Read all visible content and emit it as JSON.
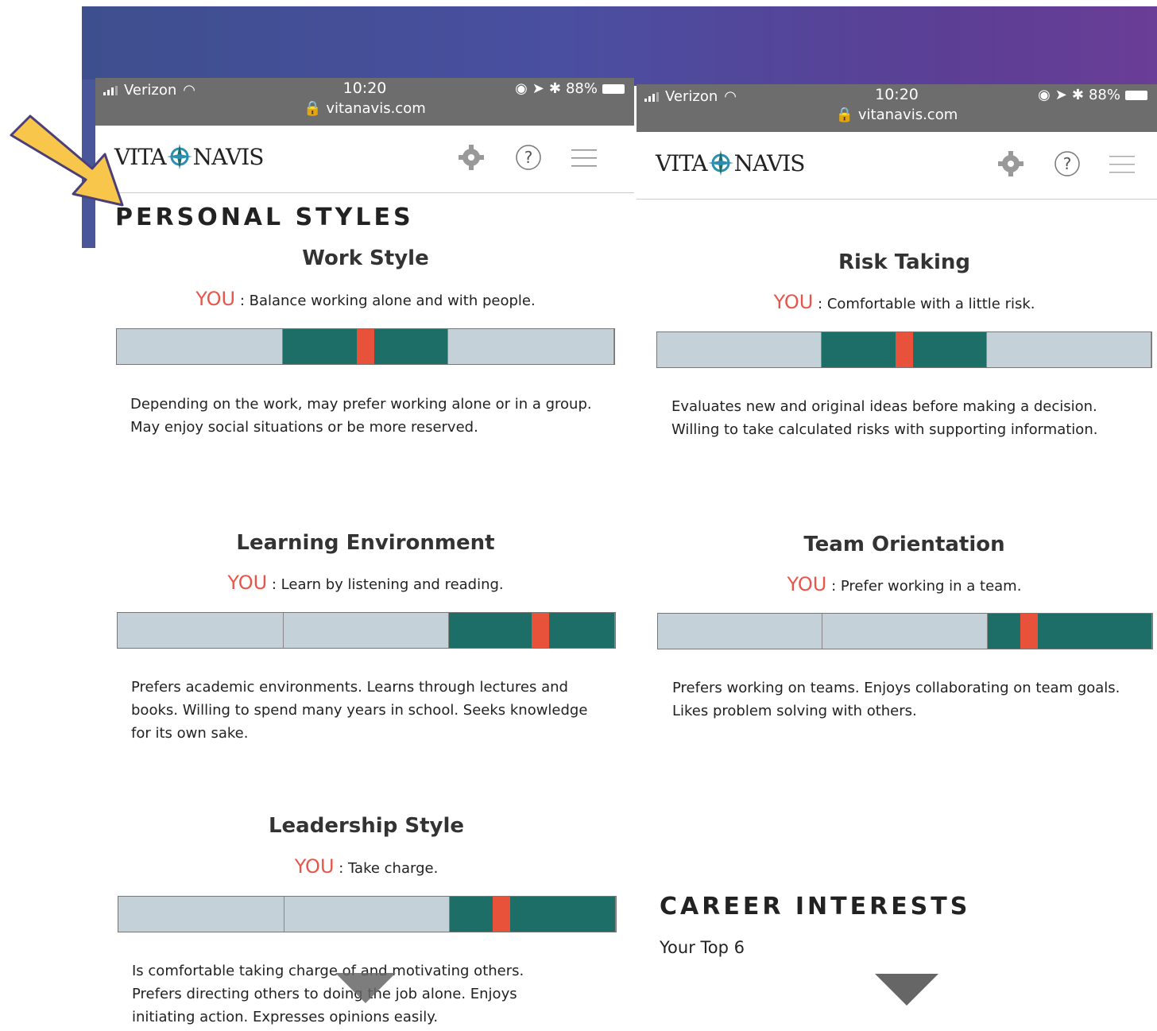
{
  "status_left": {
    "carrier": "Verizon",
    "time": "10:20",
    "url": "vitanavis.com",
    "battery": "88%"
  },
  "status_right": {
    "carrier": "Verizon",
    "time": "10:20",
    "url": "vitanavis.com",
    "battery": "88%"
  },
  "logo": {
    "left_text": "VITA",
    "right_text": "NAVIS"
  },
  "sections": {
    "personal_styles": "PERSONAL STYLES",
    "career_interests": "CAREER INTERESTS",
    "your_top": "Your Top 6"
  },
  "you_prefix": "YOU",
  "you_sep": " : ",
  "cards": {
    "work_style": {
      "title": "Work Style",
      "you_text": "Balance working alone and with people.",
      "marker": 0.5,
      "dark_segment": 2,
      "description": "Depending on the work, may prefer working alone or in a group. May enjoy social situations or be more reserved."
    },
    "risk_taking": {
      "title": "Risk Taking",
      "you_text": "Comfortable with a little risk.",
      "marker": 0.5,
      "dark_segment": 2,
      "description": "Evaluates new and original ideas before making a decision. Willing to take calculated risks with supporting information."
    },
    "learning_environment": {
      "title": "Learning Environment",
      "you_text": "Learn by listening and reading.",
      "marker": 0.85,
      "dark_segment": 3,
      "description": "Prefers academic environments. Learns through lectures and books. Willing to spend many years in school. Seeks knowledge for its own sake."
    },
    "team_orientation": {
      "title": "Team Orientation",
      "you_text": "Prefer working in a team.",
      "marker": 0.75,
      "dark_segment": 3,
      "description": "Prefers working on teams. Enjoys collaborating on team goals. Likes problem solving with others."
    },
    "leadership_style": {
      "title": "Leadership Style",
      "you_text": "Take charge.",
      "marker": 0.77,
      "dark_segment": 3,
      "description": "Is comfortable taking charge of and motivating others. Prefers directing others to doing the job alone. Enjoys initiating action. Expresses opinions easily."
    }
  },
  "colors": {
    "you": "#e8554a",
    "meter_dark": "#1d6e66",
    "meter_light": "#c5d1d8",
    "marker": "#e8523a",
    "arrow": "#f7c64a",
    "banner": "#4a4fa0"
  },
  "icons": [
    "settings-gear-icon",
    "help-question-icon",
    "hamburger-menu-icon",
    "compass-logo-icon",
    "down-triangle-icon",
    "pointer-arrow-icon"
  ]
}
